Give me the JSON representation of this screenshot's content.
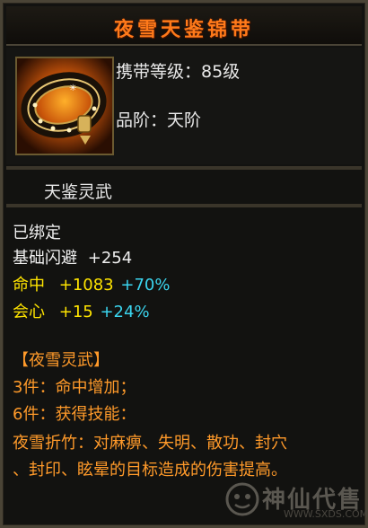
{
  "item": {
    "name": "夜雪天鉴锦带",
    "carry_level": "携带等级：85级",
    "grade": "品阶：天阶",
    "set_name": "天鉴灵武",
    "bound": "已绑定",
    "stats": [
      {
        "label": "基础闪避",
        "value": "+254",
        "bonus": ""
      },
      {
        "label": "命中",
        "value": "+1083",
        "bonus": "+70%"
      },
      {
        "label": "会心",
        "value": "+15",
        "bonus": "+24%"
      }
    ],
    "set_header": "【夜雪灵武】",
    "set_bonus_3": "3件：命中增加；",
    "set_bonus_6": "6件：获得技能：",
    "skill_line1": "夜雪折竹：对麻痹、失明、散功、封穴",
    "skill_line2": "、封印、眩晕的目标造成的伤害提高。"
  },
  "icon": {
    "name": "belt-icon"
  },
  "watermark": {
    "text": "神仙代售",
    "url": "WWW.SXDS.COM"
  },
  "colors": {
    "title": "#ff7a1a",
    "stat_value": "#ffe400",
    "bonus": "#3bd6f0",
    "set_text": "#ff9a2a"
  }
}
